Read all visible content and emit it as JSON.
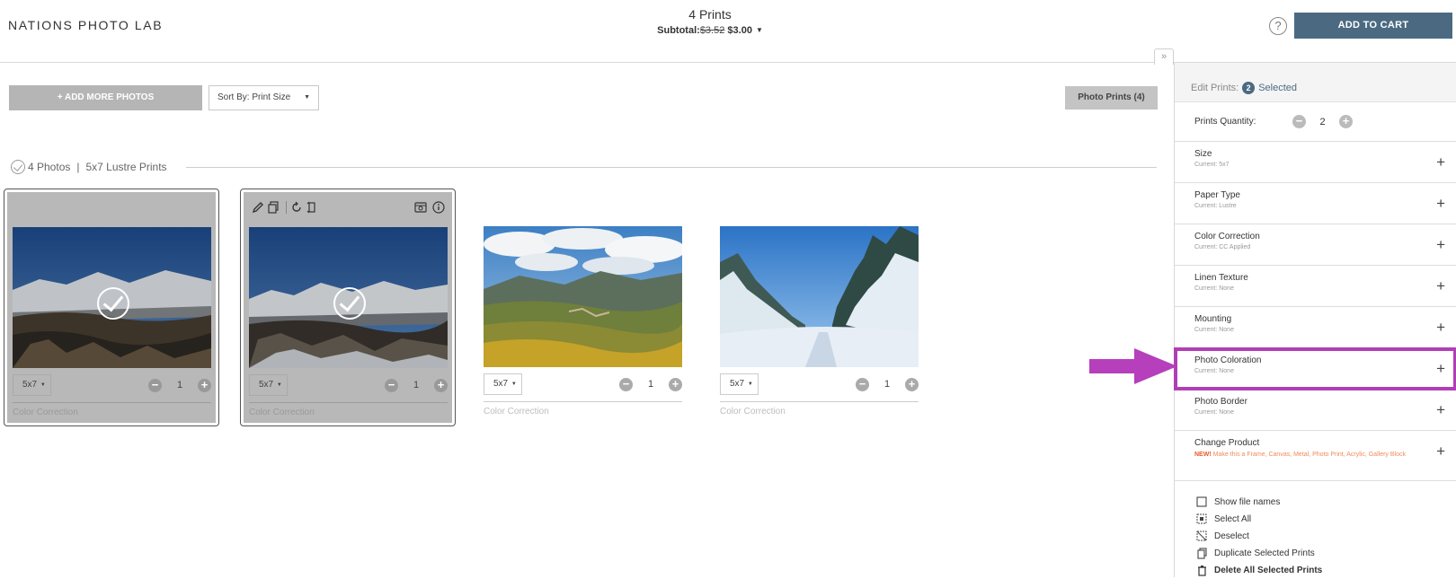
{
  "header": {
    "logo": "NATIONS PHOTO LAB",
    "prints_count": "4 Prints",
    "subtotal_label": "Subtotal:",
    "subtotal_old": "$3.52",
    "subtotal_new": "$3.00",
    "help": "?",
    "add_to_cart": "ADD TO CART",
    "collapse": "»"
  },
  "toolbar": {
    "add_photos": "+ ADD MORE PHOTOS",
    "sort_by": "Sort By: Print Size",
    "photo_prints": "Photo Prints (4)"
  },
  "group": {
    "photos": "4 Photos",
    "separator": "|",
    "print_type": "5x7 Lustre Prints"
  },
  "cards": [
    {
      "size": "5x7",
      "qty": "1",
      "color_correction": "Color Correction",
      "selected": true
    },
    {
      "size": "5x7",
      "qty": "1",
      "color_correction": "Color Correction",
      "selected": true
    },
    {
      "size": "5x7",
      "qty": "1",
      "color_correction": "Color Correction",
      "selected": false
    },
    {
      "size": "5x7",
      "qty": "1",
      "color_correction": "Color Correction",
      "selected": false
    }
  ],
  "panel": {
    "edit_prints": "Edit Prints:",
    "selected_count": "2",
    "selected_word": "Selected",
    "quantity_label": "Prints Quantity:",
    "quantity_value": "2",
    "options": [
      {
        "title": "Size",
        "current": "Current: 5x7"
      },
      {
        "title": "Paper Type",
        "current": "Current: Lustre"
      },
      {
        "title": "Color Correction",
        "current": "Current: CC Applied"
      },
      {
        "title": "Linen Texture",
        "current": "Current: None"
      },
      {
        "title": "Mounting",
        "current": "Current: None"
      },
      {
        "title": "Photo Coloration",
        "current": "Current: None"
      },
      {
        "title": "Photo Border",
        "current": "Current: None"
      },
      {
        "title": "Change Product",
        "new_tag": "NEW!",
        "new_text": "Make this a Frame, Canvas, Metal, Photo Print, Acrylic, Gallery Block"
      }
    ],
    "links": {
      "show_file_names": "Show file names",
      "select_all": "Select All",
      "deselect": "Deselect",
      "duplicate": "Duplicate Selected Prints",
      "delete": "Delete All Selected Prints"
    }
  },
  "colors": {
    "accent": "#4b6a82",
    "highlight": "#b03fb6",
    "orange": "#f08a5d"
  }
}
